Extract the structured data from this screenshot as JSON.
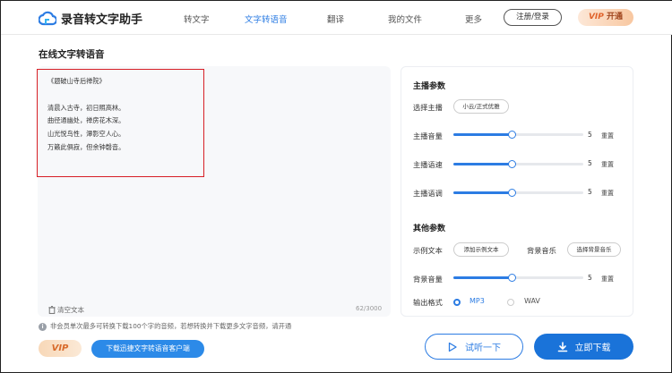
{
  "app": {
    "name": "录音转文字助手"
  },
  "nav": {
    "items": [
      "转文字",
      "文字转语音",
      "翻译",
      "我的文件",
      "更多"
    ],
    "active_index": 1
  },
  "header": {
    "login_label": "注册/登录",
    "vip_prefix": "VIP",
    "vip_label": "开通"
  },
  "page": {
    "title": "在线文字转语音"
  },
  "editor": {
    "lines": [
      "《题破山寺后禅院》",
      "",
      "清晨入古寺，初日照高林。",
      "曲径通幽处，禅房花木深。",
      "山光悦鸟性，潭影空人心。",
      "万籁此俱寂，但余钟磬音。"
    ],
    "clear_label": "清空文本",
    "counter": "62/3000"
  },
  "panel": {
    "anchor_title": "主播参数",
    "select_anchor_label": "选择主播",
    "anchor_chip": "小云/正式优雅",
    "sliders": [
      {
        "label": "主播音量",
        "value": "5",
        "fraction": 0.45,
        "reset": "重置"
      },
      {
        "label": "主播语速",
        "value": "5",
        "fraction": 0.45,
        "reset": "重置"
      },
      {
        "label": "主播语调",
        "value": "5",
        "fraction": 0.45,
        "reset": "重置"
      }
    ],
    "other_title": "其他参数",
    "sample_label": "示例文本",
    "sample_chip": "添加示例文本",
    "bgm_label": "背景音乐",
    "bgm_chip": "选择背景音乐",
    "bg_volume": {
      "label": "背景音量",
      "value": "5",
      "fraction": 0.45,
      "reset": "重置"
    },
    "format_label": "输出格式",
    "formats": [
      "MP3",
      "WAV"
    ],
    "format_selected": 0
  },
  "footer": {
    "notice": "非会员单次最多可转换下载100个字的音频，若想转换并下载更多文字音频，请开通",
    "vip_badge": "VIP",
    "client_download": "下载迅捷文字转语音客户端",
    "listen_label": "试听一下",
    "download_label": "立即下载"
  },
  "colors": {
    "accent": "#2c7ce3",
    "highlight": "#d71f26"
  }
}
